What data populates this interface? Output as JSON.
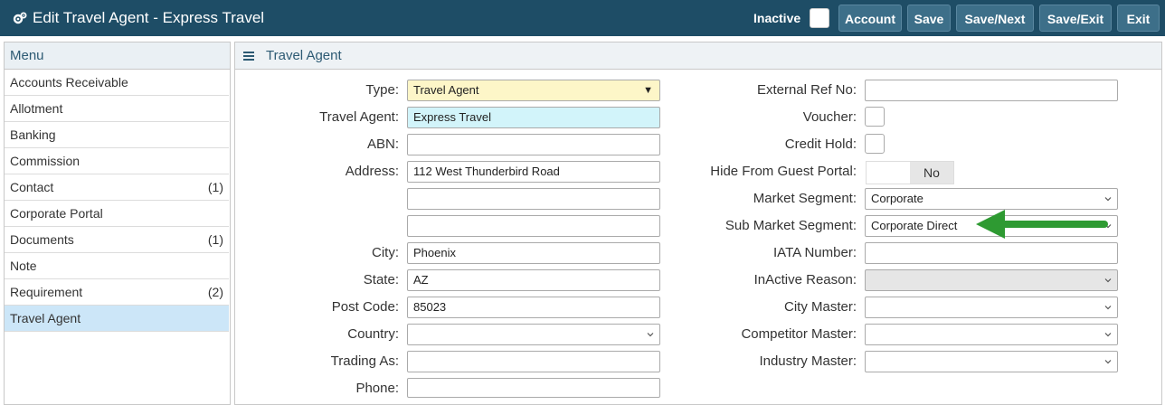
{
  "header": {
    "title": "Edit Travel Agent - Express Travel",
    "inactive_label": "Inactive",
    "buttons": [
      "Account",
      "Save",
      "Save/Next",
      "Save/Exit",
      "Exit"
    ]
  },
  "menu": {
    "title": "Menu",
    "items": [
      {
        "label": "Accounts Receivable",
        "count": ""
      },
      {
        "label": "Allotment",
        "count": ""
      },
      {
        "label": "Banking",
        "count": ""
      },
      {
        "label": "Commission",
        "count": ""
      },
      {
        "label": "Contact",
        "count": "(1)"
      },
      {
        "label": "Corporate Portal",
        "count": ""
      },
      {
        "label": "Documents",
        "count": "(1)"
      },
      {
        "label": "Note",
        "count": ""
      },
      {
        "label": "Requirement",
        "count": "(2)"
      },
      {
        "label": "Travel Agent",
        "count": ""
      }
    ]
  },
  "main": {
    "title": "Travel Agent",
    "left": {
      "type_label": "Type:",
      "type_value": "Travel Agent",
      "agent_label": "Travel Agent:",
      "agent_value": "Express Travel",
      "abn_label": "ABN:",
      "abn_value": "",
      "address_label": "Address:",
      "address1": "112 West Thunderbird Road",
      "address2": "",
      "address3": "",
      "city_label": "City:",
      "city_value": "Phoenix",
      "state_label": "State:",
      "state_value": "AZ",
      "postcode_label": "Post Code:",
      "postcode_value": "85023",
      "country_label": "Country:",
      "country_value": "",
      "trading_label": "Trading As:",
      "trading_value": "",
      "phone_label": "Phone:",
      "phone_value": ""
    },
    "right": {
      "extref_label": "External Ref No:",
      "extref_value": "",
      "voucher_label": "Voucher:",
      "credit_label": "Credit Hold:",
      "hide_label": "Hide From Guest Portal:",
      "hide_value": "No",
      "market_label": "Market Segment:",
      "market_value": "Corporate",
      "submarket_label": "Sub Market Segment:",
      "submarket_value": "Corporate Direct",
      "iata_label": "IATA Number:",
      "iata_value": "",
      "inactive_reason_label": "InActive Reason:",
      "inactive_reason_value": "",
      "city_master_label": "City Master:",
      "city_master_value": "",
      "competitor_label": "Competitor Master:",
      "competitor_value": "",
      "industry_label": "Industry Master:",
      "industry_value": ""
    }
  },
  "colors": {
    "header_bg": "#1e4d66",
    "button_bg": "#3d6f89",
    "arrow": "#2e9a32",
    "menu_active": "#cce6f8"
  }
}
